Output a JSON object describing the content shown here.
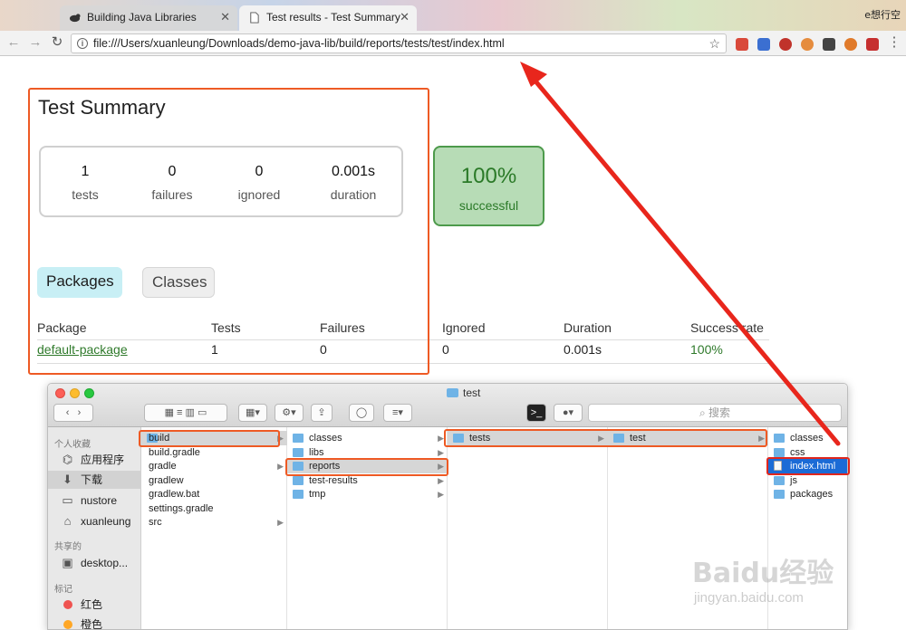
{
  "browser": {
    "tabs": [
      {
        "title": "Building Java Libraries",
        "active": false
      },
      {
        "title": "Test results - Test Summary",
        "active": true
      }
    ],
    "profile_label": "e想行空",
    "url": "file:///Users/xuanleung/Downloads/demo-java-lib/build/reports/tests/test/index.html"
  },
  "report": {
    "title": "Test Summary",
    "stats": [
      {
        "value": "1",
        "label": "tests"
      },
      {
        "value": "0",
        "label": "failures"
      },
      {
        "value": "0",
        "label": "ignored"
      },
      {
        "value": "0.001s",
        "label": "duration"
      }
    ],
    "success": {
      "value": "100%",
      "label": "successful"
    },
    "tabs": [
      "Packages",
      "Classes"
    ],
    "table": {
      "headers": [
        "Package",
        "Tests",
        "Failures",
        "Ignored",
        "Duration",
        "Success rate"
      ],
      "rows": [
        [
          "default-package",
          "1",
          "0",
          "0",
          "0.001s",
          "100%"
        ]
      ]
    }
  },
  "finder": {
    "title": "test",
    "search_placeholder": "搜索",
    "sidebar": {
      "favorites_header": "个人收藏",
      "favorites": [
        "应用程序",
        "下载",
        "nustore",
        "xuanleung"
      ],
      "shared_header": "共享的",
      "shared": [
        "desktop..."
      ],
      "tags_header": "标记",
      "tags": [
        {
          "label": "红色",
          "color": "#ef5350"
        },
        {
          "label": "橙色",
          "color": "#ffa726"
        }
      ]
    },
    "col1": [
      {
        "name": "build",
        "folder": true,
        "arrow": true
      },
      {
        "name": "build.gradle",
        "folder": false
      },
      {
        "name": "gradle",
        "folder": true,
        "arrow": true
      },
      {
        "name": "gradlew",
        "folder": false
      },
      {
        "name": "gradlew.bat",
        "folder": false
      },
      {
        "name": "settings.gradle",
        "folder": false
      },
      {
        "name": "src",
        "folder": true,
        "arrow": true
      }
    ],
    "col2": [
      {
        "name": "classes",
        "folder": true,
        "arrow": true
      },
      {
        "name": "libs",
        "folder": true,
        "arrow": true
      },
      {
        "name": "reports",
        "folder": true,
        "arrow": true
      },
      {
        "name": "test-results",
        "folder": true,
        "arrow": true
      },
      {
        "name": "tmp",
        "folder": true,
        "arrow": true
      }
    ],
    "col3": [
      {
        "name": "tests",
        "folder": true,
        "arrow": true
      }
    ],
    "col4": [
      {
        "name": "test",
        "folder": true,
        "arrow": true
      }
    ],
    "col5": [
      {
        "name": "classes",
        "folder": true
      },
      {
        "name": "css",
        "folder": true
      },
      {
        "name": "index.html",
        "folder": false
      },
      {
        "name": "js",
        "folder": true
      },
      {
        "name": "packages",
        "folder": true
      }
    ]
  },
  "watermark": {
    "brand": "Baidu经验",
    "url": "jingyan.baidu.com"
  },
  "colors": {
    "annotation": "#ee5a24",
    "success_green": "#2f7a2b",
    "selection_blue": "#1b6bd6"
  }
}
